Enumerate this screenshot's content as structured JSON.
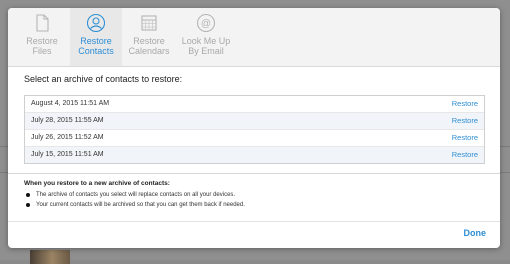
{
  "toolbar": {
    "tabs": [
      {
        "label": "Restore\nFiles",
        "icon": "document-icon"
      },
      {
        "label": "Restore\nContacts",
        "icon": "contacts-icon"
      },
      {
        "label": "Restore\nCalendars",
        "icon": "calendar-icon"
      },
      {
        "label": "Look Me Up\nBy Email",
        "icon": "at-sign-icon"
      }
    ],
    "active_tab": 1
  },
  "prompt": "Select an archive of contacts to restore:",
  "archives": [
    {
      "date": "August 4, 2015 11:51 AM",
      "action": "Restore"
    },
    {
      "date": "July 28, 2015 11:55 AM",
      "action": "Restore"
    },
    {
      "date": "July 26, 2015 11:52 AM",
      "action": "Restore"
    },
    {
      "date": "July 15, 2015 11:51 AM",
      "action": "Restore"
    }
  ],
  "notes": {
    "title": "When you restore to a new archive of contacts:",
    "items": [
      "The archive of contacts you select will replace contacts on all your devices.",
      "Your current contacts will be archived so that you can get them back if needed."
    ]
  },
  "done_label": "Done",
  "colors": {
    "accent": "#2e8ed6",
    "inactive": "#a9a9a9"
  }
}
